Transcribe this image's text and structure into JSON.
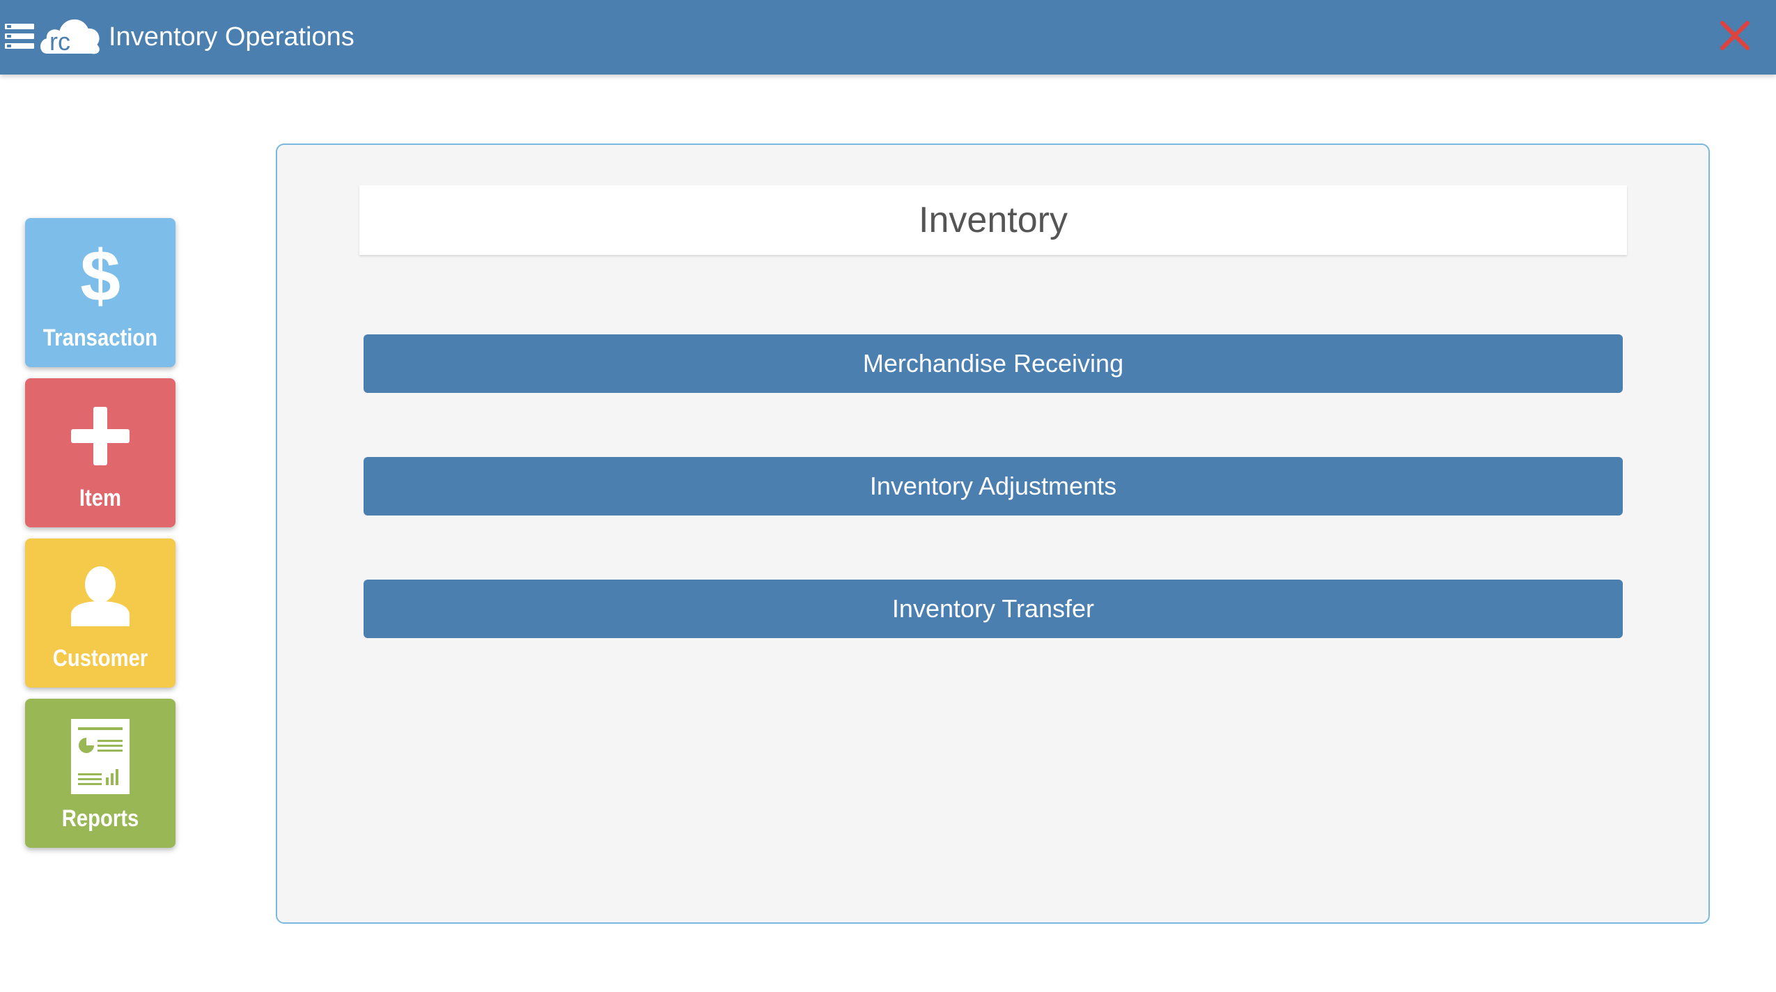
{
  "header": {
    "menu_icon": "hamburger-menu-icon",
    "logo_text": "rc",
    "title": "Inventory Operations",
    "close_icon": "close-x-icon",
    "colors": {
      "bar": "#4a7fb0",
      "close": "#e0423e"
    }
  },
  "sidebar": {
    "tiles": [
      {
        "label": "Transaction",
        "icon": "dollar-icon",
        "color": "#7cbde9"
      },
      {
        "label": "Item",
        "icon": "plus-icon",
        "color": "#e0686c"
      },
      {
        "label": "Customer",
        "icon": "person-icon",
        "color": "#f5c94a"
      },
      {
        "label": "Reports",
        "icon": "report-document-icon",
        "color": "#9ab756"
      }
    ]
  },
  "main": {
    "title": "Inventory",
    "buttons": [
      {
        "label": "Merchandise Receiving"
      },
      {
        "label": "Inventory Adjustments"
      },
      {
        "label": "Inventory Transfer"
      }
    ],
    "colors": {
      "button": "#4a7fb0",
      "panel_border": "#7ab8e0"
    }
  }
}
